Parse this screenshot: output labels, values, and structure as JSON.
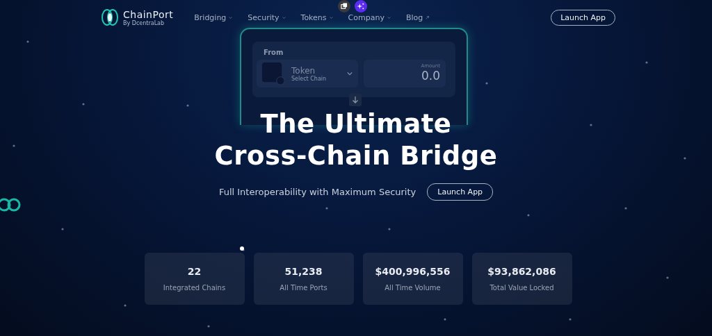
{
  "brand": {
    "name": "ChainPort",
    "tagline": "By DcentraLab"
  },
  "nav": [
    {
      "label": "Bridging",
      "kind": "dropdown"
    },
    {
      "label": "Security",
      "kind": "dropdown"
    },
    {
      "label": "Tokens",
      "kind": "dropdown"
    },
    {
      "label": "Company",
      "kind": "dropdown"
    },
    {
      "label": "Blog",
      "kind": "external"
    }
  ],
  "header_button": "Launch App",
  "swap_card": {
    "section_label": "From",
    "token": "Token",
    "chain_placeholder": "Select Chain",
    "amount_label": "Amount",
    "amount": "0.0"
  },
  "hero": {
    "title_lines": [
      "The Ultimate",
      "Cross-Chain Bridge"
    ],
    "subtitle": "Full Interoperability with Maximum Security",
    "button": "Launch App"
  },
  "stats": [
    {
      "value": "22",
      "label": "Integrated Chains"
    },
    {
      "value": "51,238",
      "label": "All Time Ports"
    },
    {
      "value": "$400,996,556",
      "label": "All Time Volume"
    },
    {
      "value": "$93,862,086",
      "label": "Total Value Locked"
    }
  ]
}
